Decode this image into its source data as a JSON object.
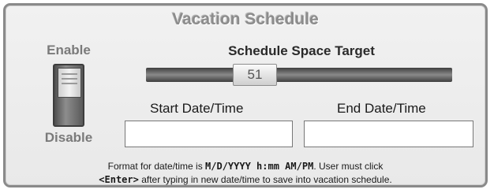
{
  "panel": {
    "title": "Vacation Schedule"
  },
  "toggle": {
    "enable_label": "Enable",
    "disable_label": "Disable"
  },
  "slider": {
    "label": "Schedule Space Target",
    "value": "51"
  },
  "start": {
    "label": "Start Date/Time",
    "value": ""
  },
  "end": {
    "label": "End Date/Time",
    "value": ""
  },
  "info": {
    "part1": "Format for date/time is ",
    "format": "M/D/YYYY h:mm AM/PM",
    "part2": ".  User must click",
    "enter": "<Enter>",
    "part3": " after typing in new date/time to save into vacation schedule."
  },
  "colors": {
    "title": "#8c8c8c",
    "panel_bg": "#eeeeee",
    "track": "#555555"
  }
}
